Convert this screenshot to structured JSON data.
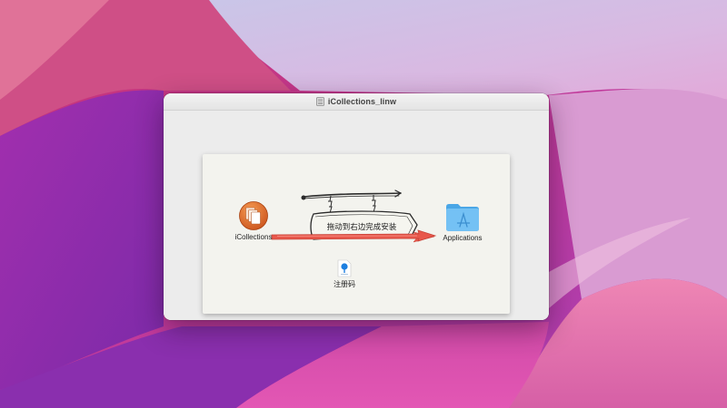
{
  "window": {
    "title": "iCollections_linw"
  },
  "dmg": {
    "sign_text": "拖动到右边完成安装",
    "items": {
      "app": {
        "label": "iCollections",
        "icon": "icollections-app-icon"
      },
      "applications": {
        "label": "Applications",
        "icon": "applications-folder-icon"
      },
      "regcode": {
        "label": "注册码",
        "icon": "document-pin-icon"
      }
    }
  },
  "colors": {
    "window_bg": "#ececec",
    "panel_bg": "#f3f3ee",
    "arrow": "#e8574b",
    "app_icon": "#e06a25",
    "folder": "#6cbcf2"
  }
}
